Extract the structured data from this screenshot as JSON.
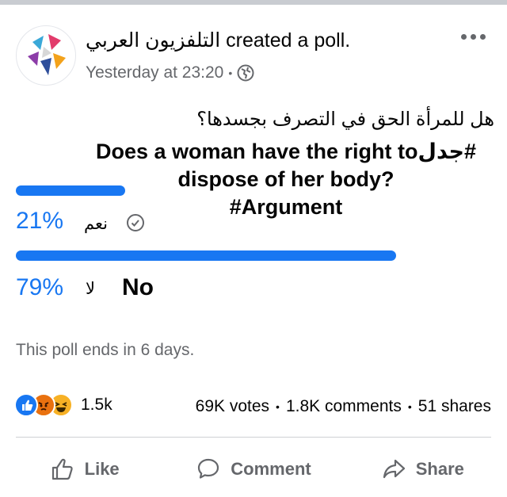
{
  "post": {
    "author": "التلفزيون العربي",
    "action": "created a poll.",
    "timestamp": "Yesterday at 23:20",
    "separator": "•",
    "privacy_icon": "globe-icon",
    "more_icon": "more-options-icon"
  },
  "question": {
    "arabic": "هل للمرأة الحق في التصرف بجسدها؟",
    "english_part1": "Does a woman have the right to",
    "hashtag_ar": "#جدل",
    "english_part2": "dispose of her body?",
    "hashtag_en": "#Argument"
  },
  "poll": {
    "options": [
      {
        "percent_label": "21%",
        "percent": 21,
        "label_ar": "نعم",
        "selected": true,
        "selected_icon": "check-circle-icon"
      },
      {
        "percent_label": "79%",
        "percent": 79,
        "label_ar": "لا",
        "label_en": "No",
        "selected": false
      }
    ],
    "ends_text": "This poll ends in 6 days."
  },
  "engagement": {
    "reactions": [
      "like-reaction-icon",
      "angry-reaction-icon",
      "haha-reaction-icon"
    ],
    "reaction_count": "1.5k",
    "votes": "69K votes",
    "comments": "1.8K comments",
    "shares": "51 shares",
    "separator": "•"
  },
  "actions": {
    "like": "Like",
    "comment": "Comment",
    "share": "Share"
  },
  "colors": {
    "accent": "#1877f2",
    "secondary_text": "#65676b",
    "divider": "#ced0d4"
  }
}
